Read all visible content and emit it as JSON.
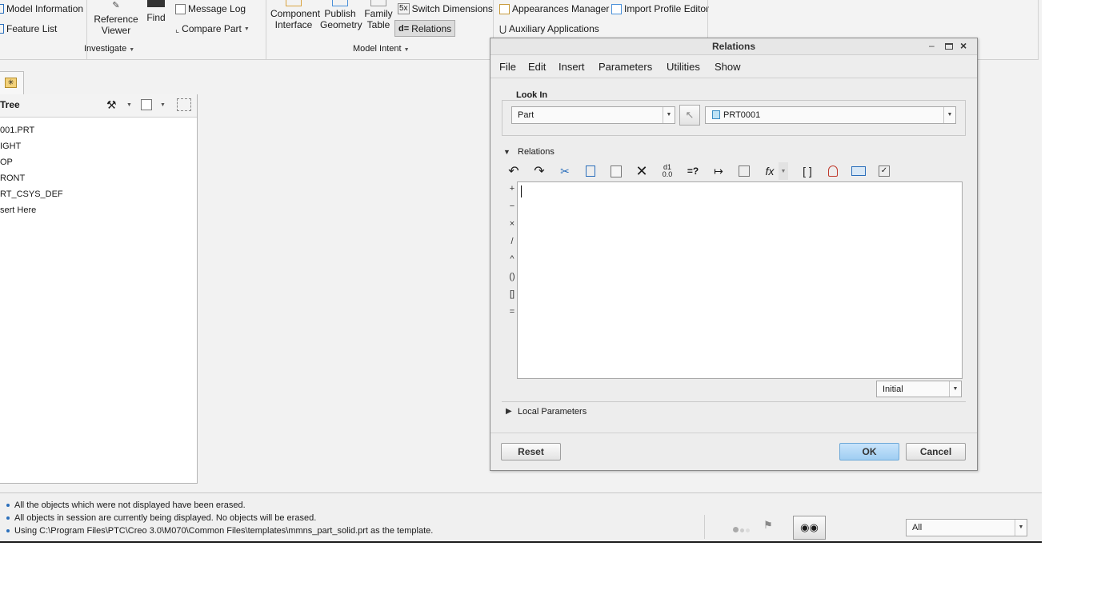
{
  "ribbon": {
    "model_information": "Model Information",
    "feature_list": "Feature List",
    "reference_viewer": [
      "Reference",
      "Viewer"
    ],
    "find": "Find",
    "message_log": "Message Log",
    "compare_part": "Compare Part",
    "component_interface": [
      "Component",
      "Interface"
    ],
    "publish_geometry": [
      "Publish",
      "Geometry"
    ],
    "family_table": [
      "Family",
      "Table"
    ],
    "switch_dimensions": "Switch Dimensions",
    "relations": "Relations",
    "appearances_manager": "Appearances Manager",
    "import_profile_editor": "Import Profile Editor",
    "auxiliary_applications": "Auxiliary Applications",
    "groups": {
      "investigate": "Investigate",
      "model_intent": "Model Intent"
    }
  },
  "tree": {
    "title": "Tree",
    "items": [
      "001.PRT",
      "IGHT",
      "OP",
      "RONT",
      "RT_CSYS_DEF",
      "sert Here"
    ]
  },
  "messages": [
    "All the objects which were not displayed have been erased.",
    "All objects in session are currently being displayed. No objects will be erased.",
    "Using C:\\Program Files\\PTC\\Creo 3.0\\M070\\Common Files\\templates\\mmns_part_solid.prt as the template."
  ],
  "status": {
    "filter": "All"
  },
  "dialog": {
    "title": "Relations",
    "menu": [
      "File",
      "Edit",
      "Insert",
      "Parameters",
      "Utilities",
      "Show"
    ],
    "look_in": {
      "label": "Look In",
      "type": "Part",
      "model": "PRT0001"
    },
    "section_relations": "Relations",
    "operators": [
      "+",
      "−",
      "×",
      "/",
      "^",
      "()",
      "[]",
      "="
    ],
    "editor_text": "",
    "sort_option": "Initial",
    "local_parameters": "Local Parameters",
    "buttons": {
      "reset": "Reset",
      "ok": "OK",
      "cancel": "Cancel"
    }
  },
  "colors": {
    "ok_button": "#a9d4f5",
    "accent": "#2a6ebb"
  }
}
